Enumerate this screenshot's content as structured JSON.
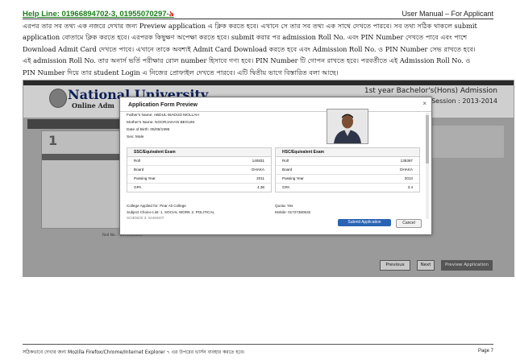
{
  "header": {
    "helpline": "Help Line: 01966894702-3, 01955070297-",
    "helpline_glyph": "৯",
    "manual_title": "User Manual – For Applicant"
  },
  "paragraph": {
    "line1": "এরপর তার সব তথ্য এক নজরে দেখার জন্য Preview application এ ক্লিক করতে হবে। এখানে সে তার সব তথ্য এক সাথে দেখতে পারবে। সব তথ্য সঠিক থাকলে submit",
    "line2": "application বোতামে ক্লিক করতে হবে। এরপরক কিছুক্ষণ অপেক্ষা করতে হবে। submit করার পর admission Roll No. এবং PIN Number দেখতে পাবে এবং পাশে",
    "line3": "Download Admit Card দেখতে পাবে। এখানে তাকে অবশ্যই Admit Card Download করতে হবে এবং Admission Roll No. ও PIN Number সেভ রাখতে হবে।",
    "line4": "এই admission Roll No. তার অনার্স ভর্তি পরীক্ষার রোল number হিসাবে গণ্য হবে। PIN Number টি গোপন রাখতে হবে। পরবর্তীতে এই Admission Roll No. ও",
    "line5": "PIN Number দিয়ে তার student Login এ নিজের প্রোফাইল দেখতে পারবে। এটি দ্বিতীয় ভাগে বিস্তারিত বলা আছে।"
  },
  "screenshot": {
    "university": "National University",
    "subtitle": "Online Adm",
    "admission_heading": "1st year Bachelor's(Hons) Admission",
    "session": "Session : 2013-2014",
    "left_step": "1",
    "roll_label": "Roll No. : 8170000000",
    "buttons": {
      "previous": "Previous",
      "next": "Next",
      "preview": "Preview Application"
    },
    "modal": {
      "title": "Application Form Preview",
      "close_symbol": "×",
      "student": {
        "father": "Father's Name:  ABDUL WADUD MOLLAH",
        "mother": "Mother's Name:  NOORJAHAN BEGUM",
        "dob": "Date of Birth:  05/09/1996",
        "sex": "Sex:  Male"
      },
      "ssc": {
        "title": "SSC/Equivalent Exam",
        "rows": [
          {
            "k": "Roll",
            "v": "140831"
          },
          {
            "k": "Board",
            "v": "DHAKA"
          },
          {
            "k": "Passing Year",
            "v": "2011"
          },
          {
            "k": "GPA",
            "v": "4.38"
          }
        ]
      },
      "hsc": {
        "title": "HSC/Equivalent Exam",
        "rows": [
          {
            "k": "Roll",
            "v": "138397"
          },
          {
            "k": "Board",
            "v": "DHAKA"
          },
          {
            "k": "Passing Year",
            "v": "2013"
          },
          {
            "k": "GPA",
            "v": "3.4"
          }
        ]
      },
      "college": "College Applied for:  Pear Ali College",
      "subject_choice": "Subject Choice List:  1. SOCIAL WORK 2. POLITICAL",
      "subject_choice2": "SCIENCE 3. SANSKIT",
      "quota": "Quota:  Yes",
      "mobile": "Mobile:  01727360532",
      "submit_label": "Submit Application",
      "cancel_label": "Cancel"
    }
  },
  "footer": {
    "note": "সঠিকভাবে দেখার জন্য  Mozilla Firefox/Chrome/Internet Explorer ৭ এর উপরের ভার্সন ব্যবহার করতে হবে।",
    "page": "Page 7"
  },
  "colors": {
    "helpline": "#1a7d1a",
    "submit_button": "#2a62b3",
    "university_title": "#0b1f55"
  }
}
